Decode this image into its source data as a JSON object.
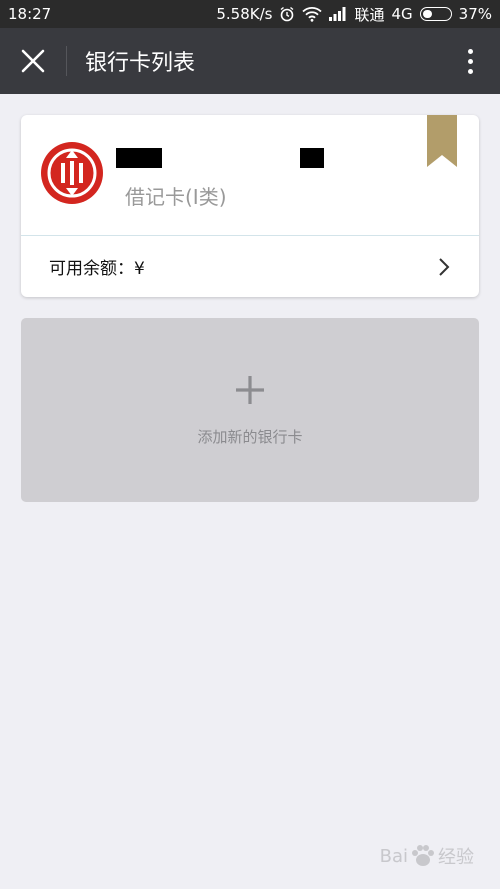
{
  "status_bar": {
    "time": "18:27",
    "speed": "5.58K/s",
    "carrier": "联通",
    "network": "4G",
    "battery_percent": "37%",
    "battery_level": 0.37
  },
  "app_bar": {
    "title": "银行卡列表",
    "close_icon": "close-icon",
    "more_icon": "more-vert-icon"
  },
  "card": {
    "type": "借记卡(I类)",
    "balance_label": "可用余额：¥",
    "logo": "citic-bank-logo",
    "brand_color": "#d3261f",
    "bookmark_color": "#b29d6a"
  },
  "add_card": {
    "label": "添加新的银行卡"
  },
  "watermark": {
    "prefix": "Bai",
    "suffix": "经验"
  }
}
